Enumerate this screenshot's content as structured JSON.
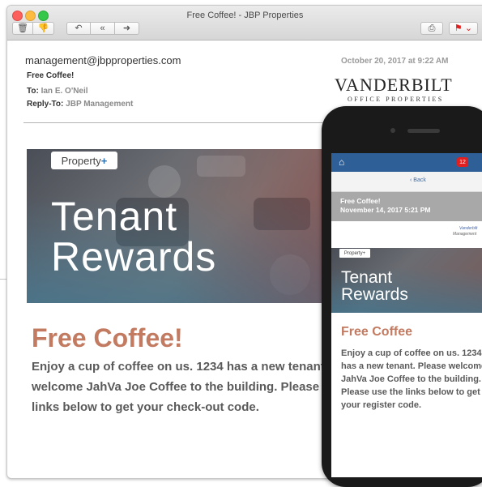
{
  "window": {
    "title": "Free Coffee! - JBP Properties"
  },
  "toolbar": {
    "trash_glyph": "🗑",
    "junk_glyph": "👎",
    "reply_glyph": "↶",
    "replyall_glyph": "«",
    "forward_glyph": "➜",
    "print_glyph": "⎙",
    "flag_glyph": "⚑ ⌄"
  },
  "email": {
    "from": "management@jbpproperties.com",
    "subject": "Free Coffee!",
    "to_label": "To:",
    "to_value": "Ian E. O'Neil",
    "replyto_label": "Reply-To:",
    "replyto_value": "JBP Management",
    "date": "October 20, 2017 at 9:22 AM"
  },
  "logo": {
    "main": "VANDERBILT",
    "sub": "OFFICE PROPERTIES"
  },
  "hero": {
    "badge_text": "Property",
    "badge_plus": "+",
    "line1": "Tenant",
    "line2": "Rewards"
  },
  "body": {
    "headline": "Free Coffee!",
    "text": "Enjoy a cup of coffee on us. 1234 has a new tenant. Please welcome JahVa Joe Coffee to the building. Please use the links below to get your check-out code."
  },
  "phone": {
    "home_glyph": "⌂",
    "badge": "12",
    "back": "‹ Back",
    "subject": "Free Coffee!",
    "date": "November 14, 2017 5:21 PM",
    "logo_a": "Vanderbilt",
    "logo_b": "Management",
    "hero_badge": "Property+",
    "hero_line1": "Tenant",
    "hero_line2": "Rewards",
    "headline": "Free Coffee",
    "text": "Enjoy a cup of coffee on us. 1234 has a new tenant. Please welcome JahVa Joe Coffee to the building. Please use the links below to get your register code."
  },
  "colors": {
    "accent": "#c27a60",
    "nav": "#2f5f97",
    "badge": "#e02020"
  }
}
